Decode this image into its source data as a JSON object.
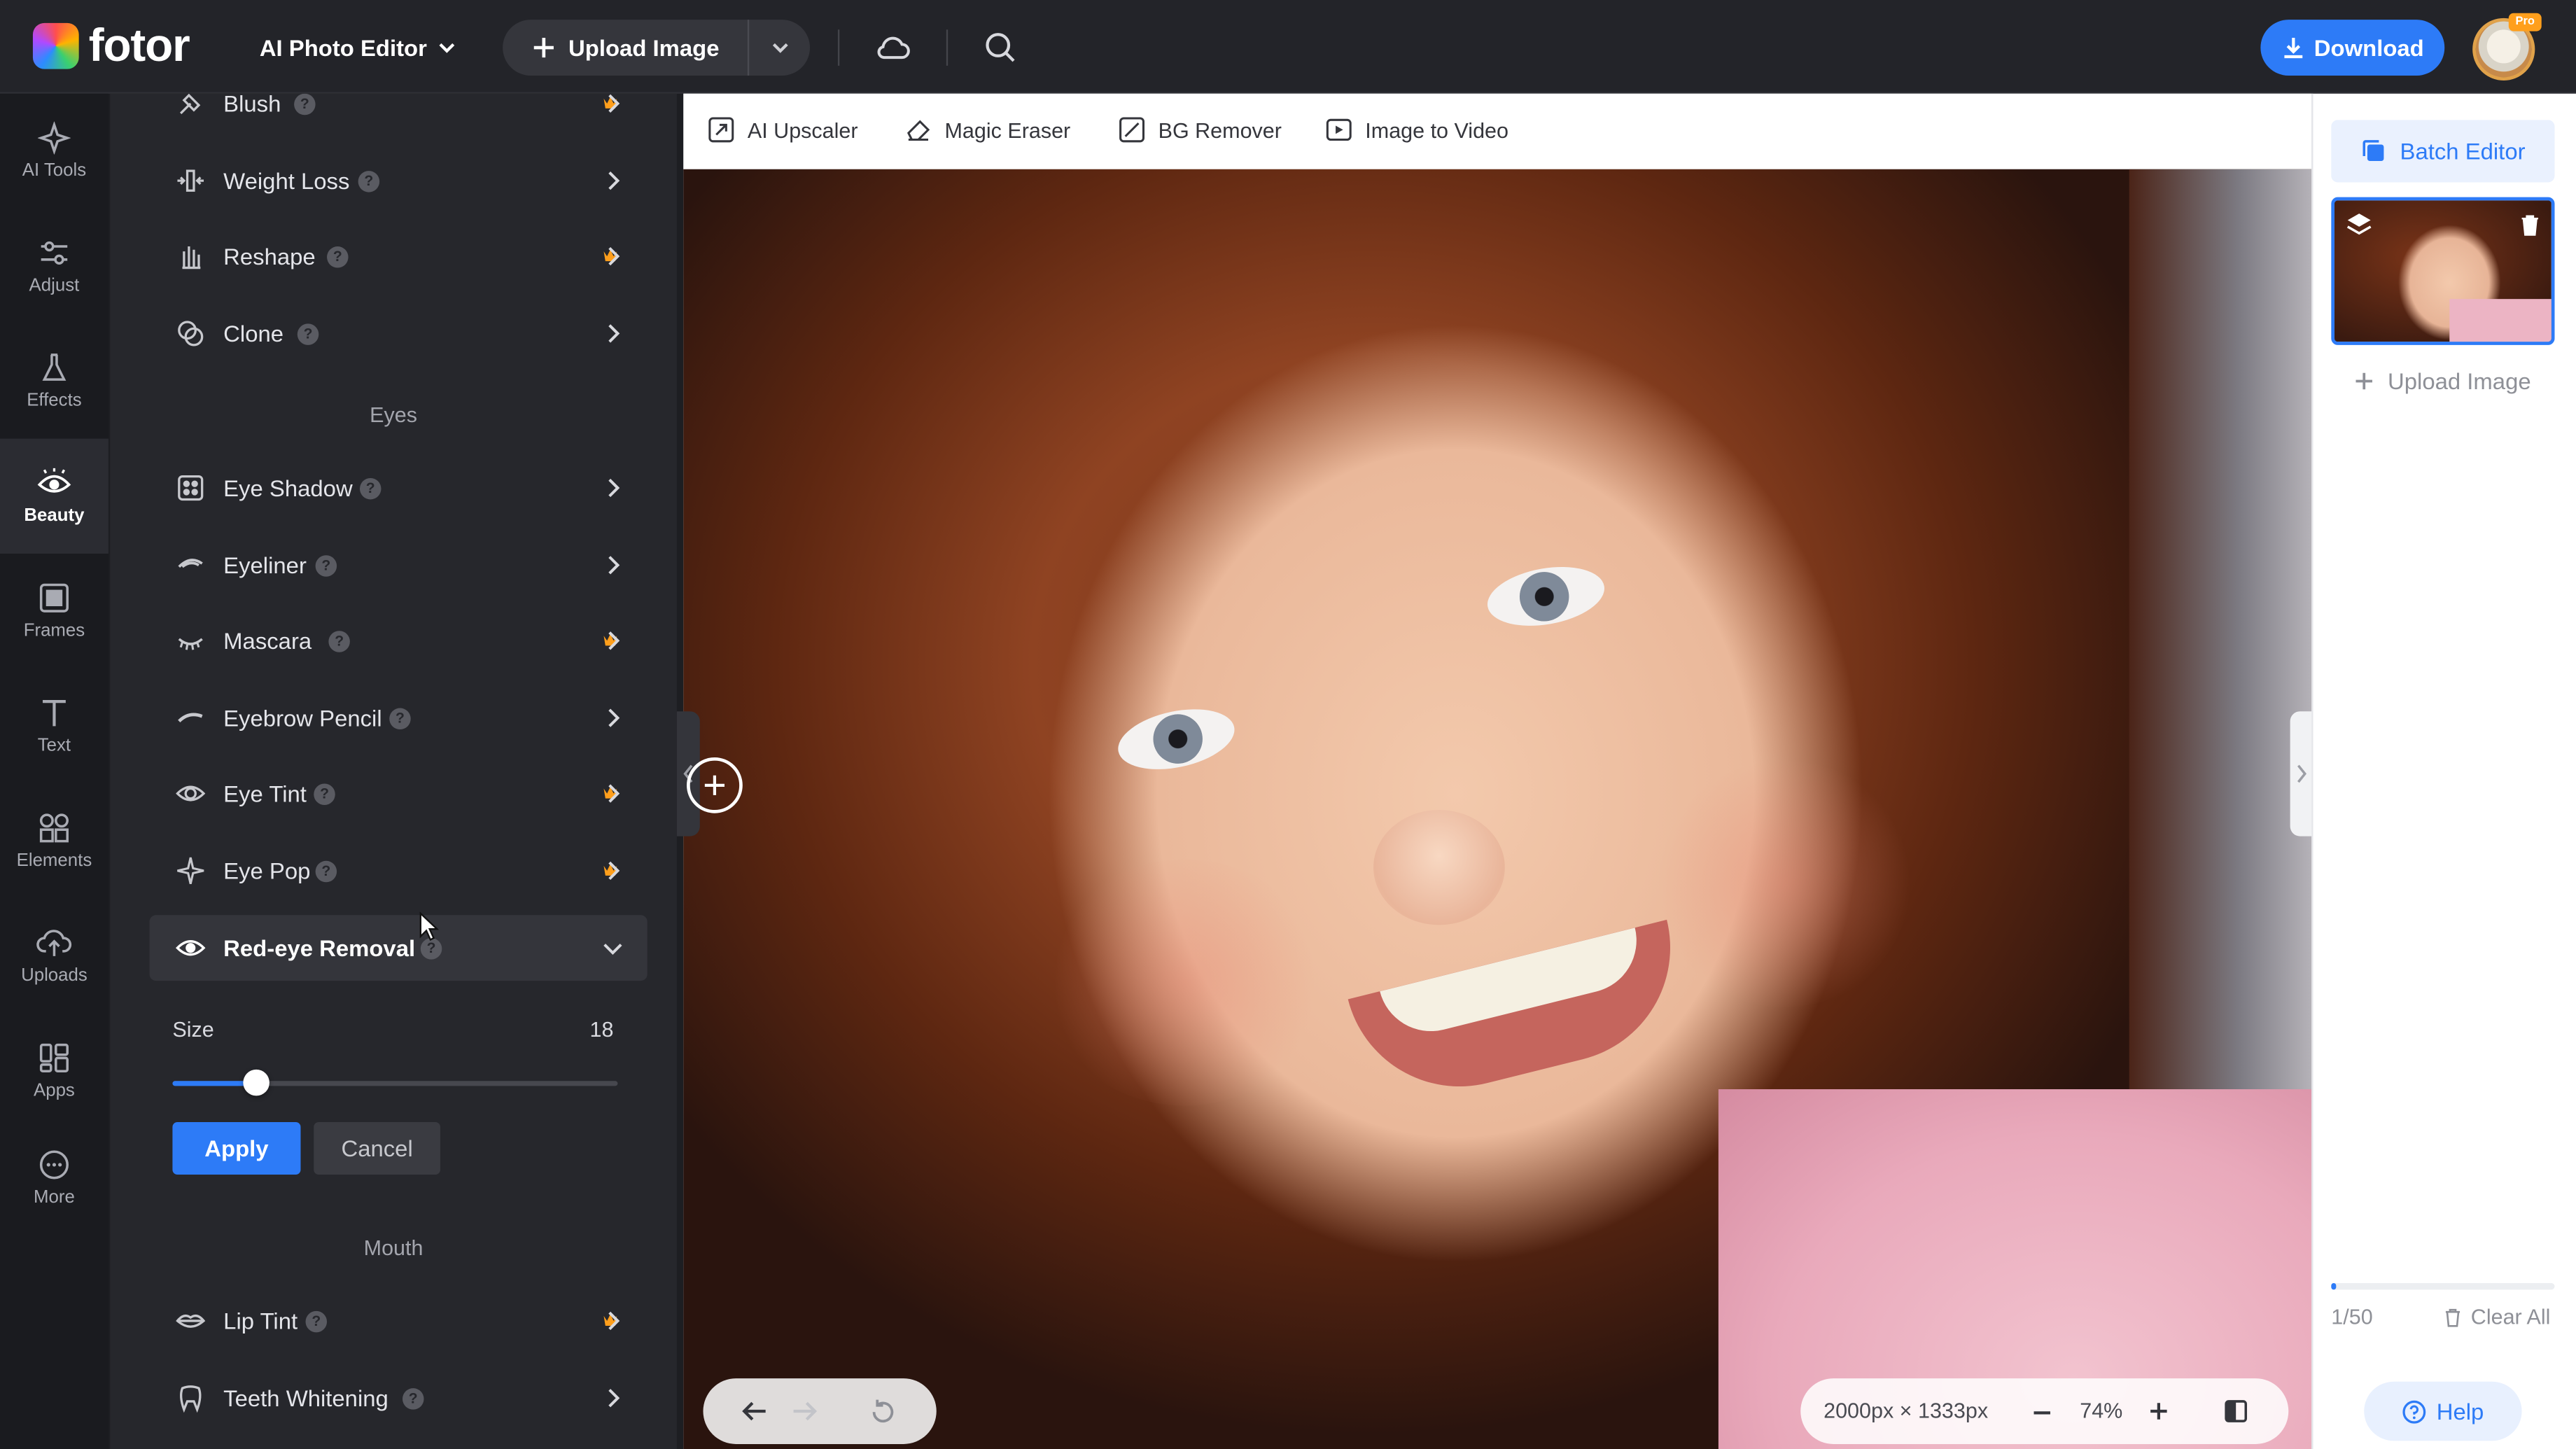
{
  "app": {
    "logo_text": "fotor",
    "accent": "#2d7bf7",
    "pro_color": "#ff9f1c"
  },
  "topbar": {
    "editor_menu": "AI Photo Editor",
    "upload_label": "Upload Image",
    "download_label": "Download",
    "pro_badge": "Pro",
    "icons": [
      "cloud-icon",
      "search-icon"
    ]
  },
  "rail": {
    "items": [
      {
        "label": "AI Tools",
        "icon": "ai-tools-icon"
      },
      {
        "label": "Adjust",
        "icon": "sliders-icon"
      },
      {
        "label": "Effects",
        "icon": "flask-icon"
      },
      {
        "label": "Beauty",
        "icon": "eye-icon",
        "active": true
      },
      {
        "label": "Frames",
        "icon": "frame-icon"
      },
      {
        "label": "Text",
        "icon": "text-icon"
      },
      {
        "label": "Elements",
        "icon": "shapes-icon"
      },
      {
        "label": "Uploads",
        "icon": "cloud-upload-icon"
      },
      {
        "label": "Apps",
        "icon": "apps-icon"
      },
      {
        "label": "More",
        "icon": "more-icon"
      }
    ]
  },
  "panel": {
    "tools_top": [
      {
        "label": "Blush",
        "pro": true
      },
      {
        "label": "Weight Loss",
        "pro": false
      },
      {
        "label": "Reshape",
        "pro": true
      },
      {
        "label": "Clone",
        "pro": false
      }
    ],
    "section_eyes": "Eyes",
    "eye_tools": [
      {
        "label": "Eye Shadow",
        "pro": false
      },
      {
        "label": "Eyeliner",
        "pro": false
      },
      {
        "label": "Mascara",
        "pro": true
      },
      {
        "label": "Eyebrow Pencil",
        "pro": false
      },
      {
        "label": "Eye Tint",
        "pro": true
      },
      {
        "label": "Eye Pop",
        "pro": true
      }
    ],
    "expanded_tool": {
      "label": "Red-eye Removal"
    },
    "size": {
      "label": "Size",
      "value": "18",
      "fraction": 0.19
    },
    "apply_label": "Apply",
    "cancel_label": "Cancel",
    "section_mouth": "Mouth",
    "mouth_tools": [
      {
        "label": "Lip Tint",
        "pro": true
      },
      {
        "label": "Teeth Whitening",
        "pro": false
      }
    ]
  },
  "subtoolbar": {
    "items": [
      {
        "label": "AI Upscaler",
        "icon": "upscale-icon"
      },
      {
        "label": "Magic Eraser",
        "icon": "eraser-icon"
      },
      {
        "label": "BG Remover",
        "icon": "bg-remover-icon"
      },
      {
        "label": "Image to Video",
        "icon": "video-icon"
      }
    ]
  },
  "canvas": {
    "dimensions": "2000px × 1333px",
    "zoom": "74%"
  },
  "right_panel": {
    "batch_label": "Batch Editor",
    "upload_label": "Upload Image",
    "count": "1/50",
    "count_fraction": 0.02,
    "clear_label": "Clear All",
    "help_label": "Help"
  }
}
